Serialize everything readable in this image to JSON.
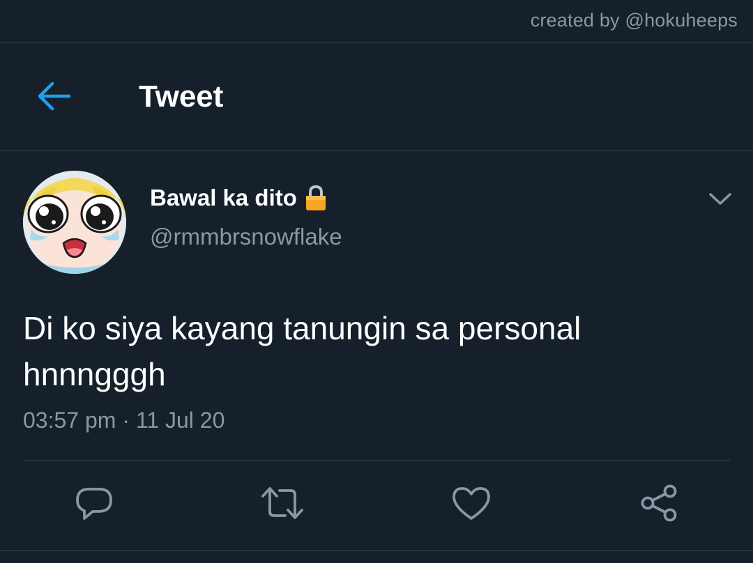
{
  "watermark": "created by @hokuheeps",
  "header": {
    "title": "Tweet",
    "back_icon": "arrow-left-icon"
  },
  "tweet": {
    "display_name": "Bawal ka dito",
    "protected_icon": "lock-icon",
    "handle": "@rmmbrsnowflake",
    "text": "Di ko siya kayang tanungin sa personal hnnngggh",
    "timestamp": "03:57 pm · 11 Jul 20",
    "menu_icon": "chevron-down-icon"
  },
  "actions": [
    {
      "name": "reply",
      "icon": "speech-bubble-icon"
    },
    {
      "name": "retweet",
      "icon": "retweet-icon"
    },
    {
      "name": "like",
      "icon": "heart-icon"
    },
    {
      "name": "share",
      "icon": "share-icon"
    }
  ],
  "colors": {
    "background": "#15202b",
    "accent": "#1da1f2",
    "muted_text": "#8899a6",
    "divider": "#38444d",
    "lock": "#f5a623"
  }
}
